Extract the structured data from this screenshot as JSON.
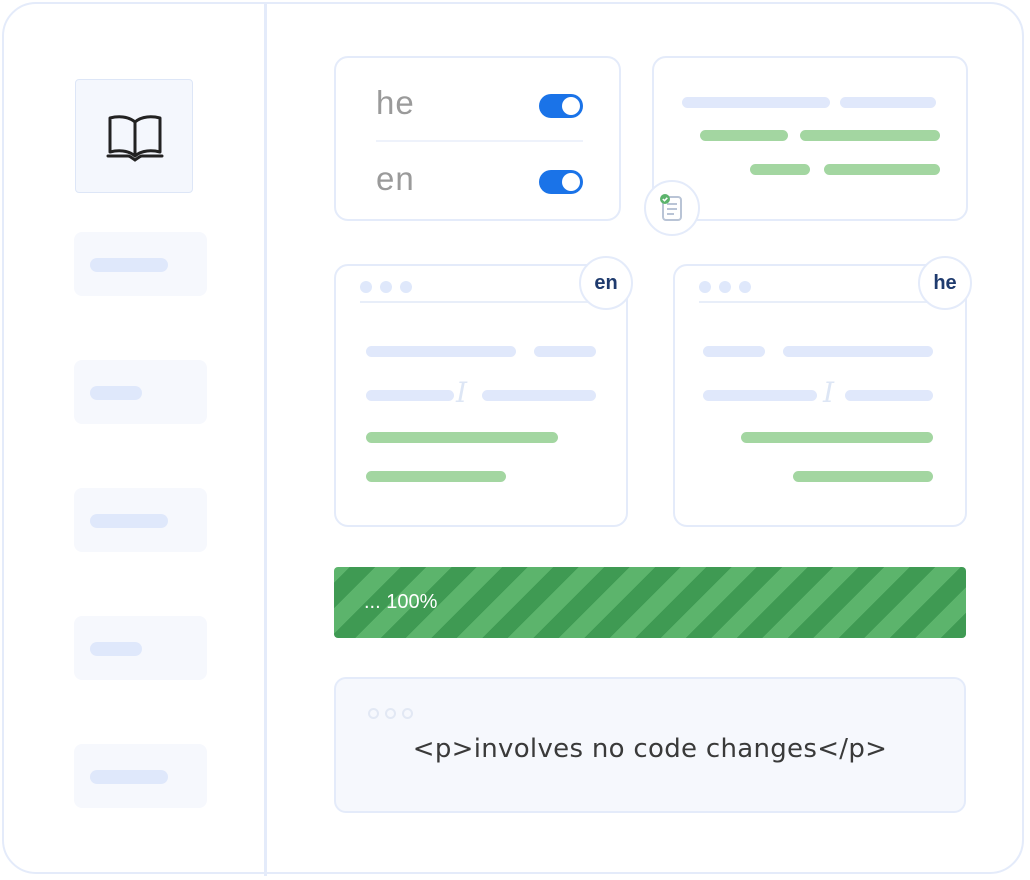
{
  "languages": [
    {
      "label": "he",
      "enabled": true
    },
    {
      "label": "en",
      "enabled": true
    }
  ],
  "preview_cards": [
    {
      "badge": "en"
    },
    {
      "badge": "he"
    }
  ],
  "progress": {
    "label": "... 100%",
    "value": 100
  },
  "code_snippet": "<p>involves no code changes</p>",
  "colors": {
    "accent": "#1a73e8",
    "success": "#3f9a53",
    "border": "#e4ebfa"
  },
  "icons": {
    "logo": "open-book-icon",
    "doc_check": "document-check-icon"
  }
}
